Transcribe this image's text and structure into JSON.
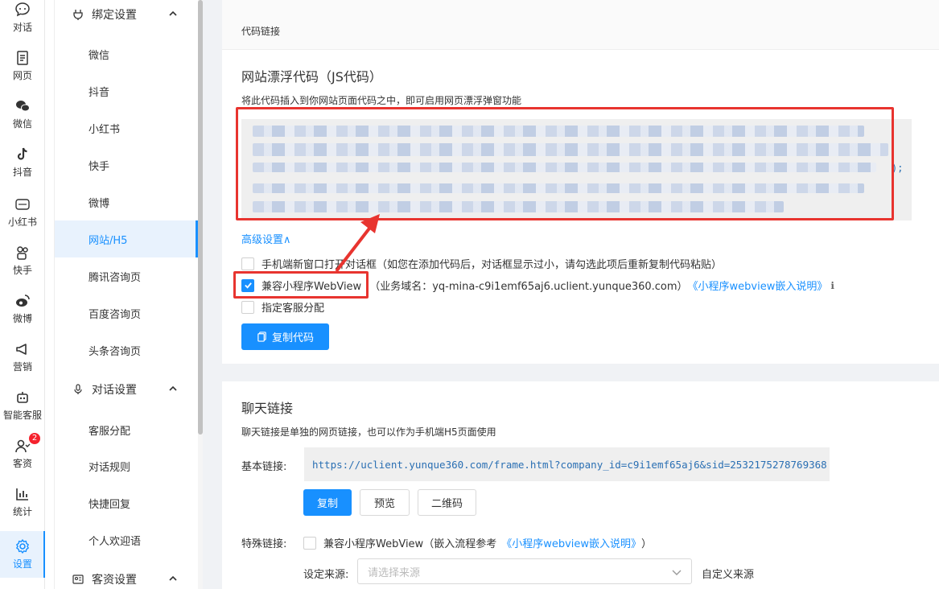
{
  "rail": [
    {
      "label": "对话",
      "icon": "chat-icon"
    },
    {
      "label": "网页",
      "icon": "webpage-icon"
    },
    {
      "label": "微信",
      "icon": "wechat-icon"
    },
    {
      "label": "抖音",
      "icon": "tiktok-icon"
    },
    {
      "label": "小红书",
      "icon": "xiaohongshu-icon"
    },
    {
      "label": "快手",
      "icon": "kuaishou-icon"
    },
    {
      "label": "微博",
      "icon": "weibo-icon"
    },
    {
      "label": "营销",
      "icon": "megaphone-icon"
    },
    {
      "label": "智能客服",
      "icon": "robot-icon"
    },
    {
      "label": "客资",
      "icon": "contacts-icon",
      "badge": "2"
    },
    {
      "label": "统计",
      "icon": "stats-icon"
    },
    {
      "label": "设置",
      "icon": "settings-icon",
      "active": true
    }
  ],
  "submenu": {
    "group_binding": "绑定设置",
    "binding_items": [
      "微信",
      "抖音",
      "小红书",
      "快手",
      "微博",
      "网站/H5",
      "腾讯咨询页",
      "百度咨询页",
      "头条咨询页"
    ],
    "active_item": "网站/H5",
    "group_dialog": "对话设置",
    "dialog_items": [
      "客服分配",
      "对话规则",
      "快捷回复",
      "个人欢迎语"
    ],
    "group_leads": "客资设置"
  },
  "card1": {
    "header": "代码链接",
    "title": "网站漂浮代码（JS代码）",
    "desc": "将此代码插入到你网站页面代码之中，即可启用网页漂浮弹窗功能",
    "code_tail": ");",
    "advanced_link": "高级设置∧",
    "opt_mobile": "手机端新窗口打开对话框（如您在添加代码后，对话框显示过小，请勾选此项后重新复制代码粘贴）",
    "opt_webview": "兼容小程序WebView",
    "opt_webview_domain": "（业务域名：yq-mina-c9i1emf65aj6.uclient.yunque360.com）",
    "opt_webview_link": "《小程序webview嵌入说明》",
    "opt_webview_info": "ℹ",
    "opt_assign": "指定客服分配",
    "copy_btn": "复制代码"
  },
  "card2": {
    "title": "聊天链接",
    "desc": "聊天链接是单独的网页链接，也可以作为手机端H5页面使用",
    "basic_label": "基本链接:",
    "basic_url": "https://uclient.yunque360.com/frame.html?company_id=c9i1emf65aj6&sid=2532175278769368",
    "btn_copy": "复制",
    "btn_preview": "预览",
    "btn_qr": "二维码",
    "special_label": "特殊链接:",
    "special_opt": "兼容小程序WebView（嵌入流程参考",
    "special_link": "《小程序webview嵌入说明》",
    "special_close": "）",
    "source_label": "设定来源:",
    "source_placeholder": "请选择来源",
    "custom_source": "自定义来源"
  },
  "colors": {
    "accent": "#1890ff",
    "highlight": "#e8342f"
  }
}
